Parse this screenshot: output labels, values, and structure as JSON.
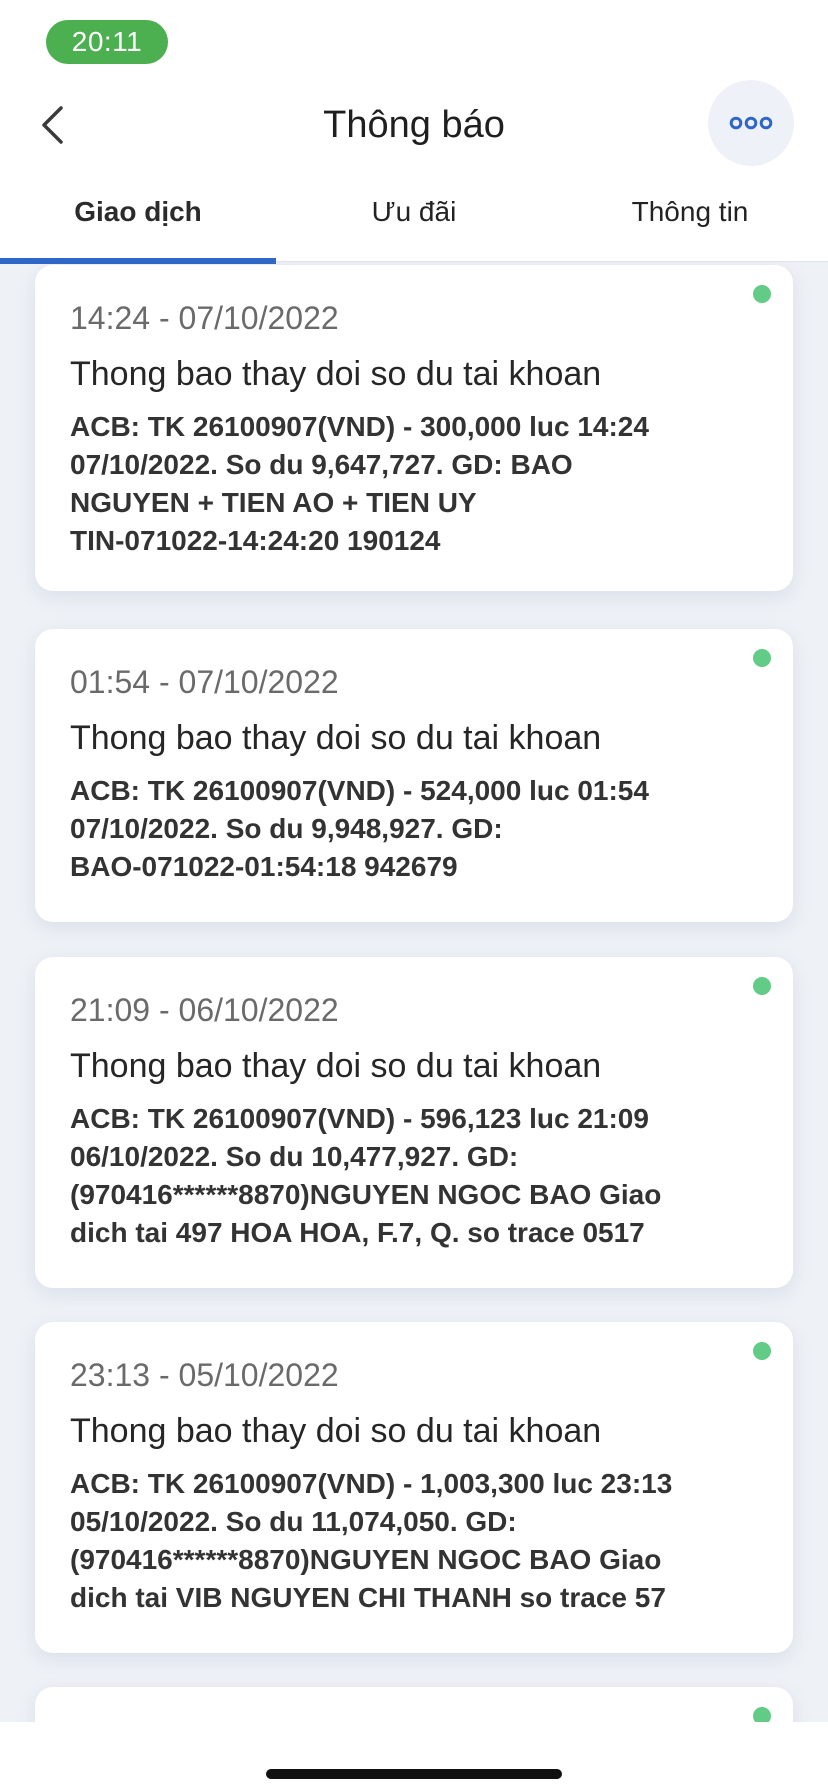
{
  "status_bar": {
    "time": "20:11"
  },
  "header": {
    "title": "Thông báo",
    "back_icon": "chevron-left-icon",
    "more_icon": "ellipsis-icon",
    "accent_color": "#2f67c8"
  },
  "tabs": [
    {
      "label": "Giao dịch",
      "active": true
    },
    {
      "label": "Ưu đãi",
      "active": false
    },
    {
      "label": "Thông tin",
      "active": false
    }
  ],
  "notifications": [
    {
      "timestamp": "14:24 - 07/10/2022",
      "title": "Thong bao thay doi so du tai khoan",
      "lines": [
        "ACB: TK 26100907(VND) - 300,000 luc 14:24",
        "07/10/2022. So du 9,647,727. GD: BAO",
        "NGUYEN + TIEN AO + TIEN UY",
        "TIN-071022-14:24:20 190124"
      ],
      "unread": true
    },
    {
      "timestamp": "01:54 - 07/10/2022",
      "title": "Thong bao thay doi so du tai khoan",
      "lines": [
        "ACB: TK 26100907(VND) - 524,000 luc 01:54",
        "07/10/2022. So du 9,948,927. GD:",
        "BAO-071022-01:54:18 942679"
      ],
      "unread": true
    },
    {
      "timestamp": "21:09 - 06/10/2022",
      "title": "Thong bao thay doi so du tai khoan",
      "lines": [
        "ACB: TK 26100907(VND) - 596,123 luc 21:09",
        "06/10/2022. So du 10,477,927. GD:",
        "(970416******8870)NGUYEN NGOC BAO Giao",
        "dich tai 497 HOA HOA, F.7, Q. so trace 0517"
      ],
      "unread": true
    },
    {
      "timestamp": "23:13 - 05/10/2022",
      "title": "Thong bao thay doi so du tai khoan",
      "lines": [
        "ACB: TK 26100907(VND) - 1,003,300 luc 23:13",
        "05/10/2022. So du 11,074,050. GD:",
        "(970416******8870)NGUYEN NGOC BAO Giao",
        "dich tai VIB NGUYEN CHI THANH so trace 57"
      ],
      "unread": true
    },
    {
      "timestamp": "",
      "title": "",
      "lines": [],
      "unread": true
    }
  ],
  "colors": {
    "status_pill": "#4caf50",
    "unread_dot": "#62cb86",
    "background": "#eef1f6"
  }
}
